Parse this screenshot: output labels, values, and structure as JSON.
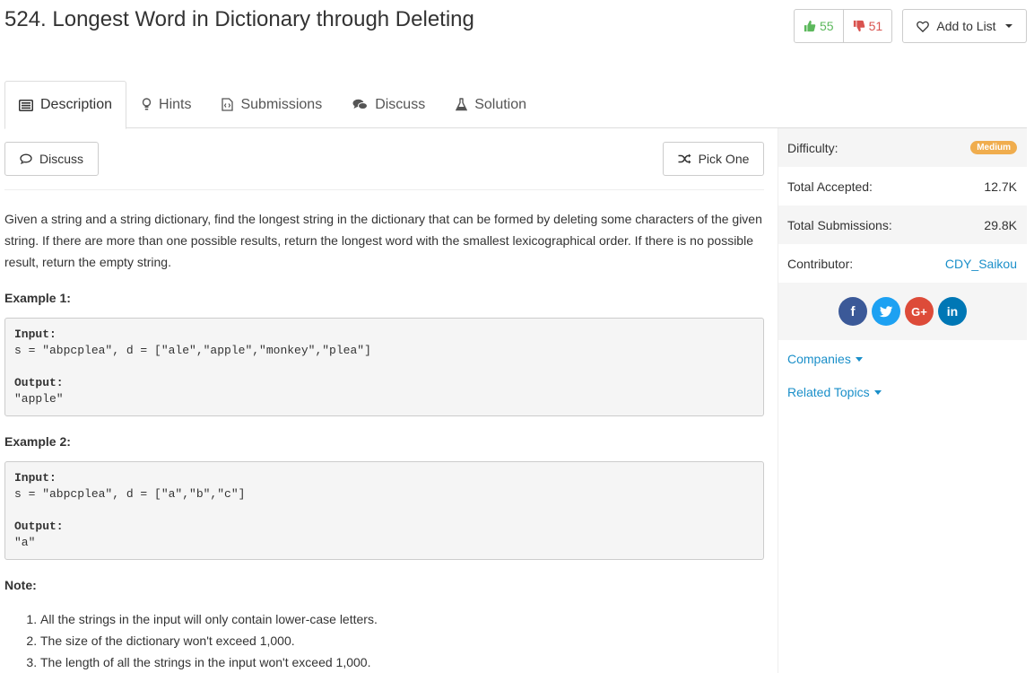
{
  "header": {
    "title": "524. Longest Word in Dictionary through Deleting",
    "upvotes": "55",
    "downvotes": "51",
    "add_to_list": "Add to List"
  },
  "tabs": [
    {
      "label": "Description",
      "icon": "description-icon"
    },
    {
      "label": "Hints",
      "icon": "lightbulb-icon"
    },
    {
      "label": "Submissions",
      "icon": "code-file-icon"
    },
    {
      "label": "Discuss",
      "icon": "comments-icon"
    },
    {
      "label": "Solution",
      "icon": "flask-icon"
    }
  ],
  "toolbar": {
    "discuss_label": "Discuss",
    "pick_one_label": "Pick One"
  },
  "problem": {
    "description": "Given a string and a string dictionary, find the longest string in the dictionary that can be formed by deleting some characters of the given string. If there are more than one possible results, return the longest word with the smallest lexicographical order. If there is no possible result, return the empty string.",
    "example1_title": "Example 1:",
    "example1": {
      "input_label": "Input:",
      "input": "s = \"abpcplea\", d = [\"ale\",\"apple\",\"monkey\",\"plea\"]",
      "output_label": "Output:",
      "output": "\"apple\""
    },
    "example2_title": "Example 2:",
    "example2": {
      "input_label": "Input:",
      "input": "s = \"abpcplea\", d = [\"a\",\"b\",\"c\"]",
      "output_label": "Output:",
      "output": "\"a\""
    },
    "note_title": "Note:",
    "notes": [
      "All the strings in the input will only contain lower-case letters.",
      "The size of the dictionary won't exceed 1,000.",
      "The length of all the strings in the input won't exceed 1,000."
    ]
  },
  "sidebar": {
    "difficulty_label": "Difficulty:",
    "difficulty_value": "Medium",
    "accepted_label": "Total Accepted:",
    "accepted_value": "12.7K",
    "submissions_label": "Total Submissions:",
    "submissions_value": "29.8K",
    "contributor_label": "Contributor:",
    "contributor_value": "CDY_Saikou",
    "social": [
      {
        "name": "facebook",
        "glyph": "f",
        "color": "#3b5998"
      },
      {
        "name": "twitter",
        "glyph": "t",
        "color": "#1da1f2"
      },
      {
        "name": "google-plus",
        "glyph": "G+",
        "color": "#dd4b39"
      },
      {
        "name": "linkedin",
        "glyph": "in",
        "color": "#0077b5"
      }
    ],
    "companies_label": "Companies",
    "related_topics_label": "Related Topics"
  },
  "colors": {
    "accent_link": "#1a8fc9",
    "medium_badge": "#f0ad4e",
    "upvote": "#5cb85c",
    "downvote": "#d9534f"
  }
}
